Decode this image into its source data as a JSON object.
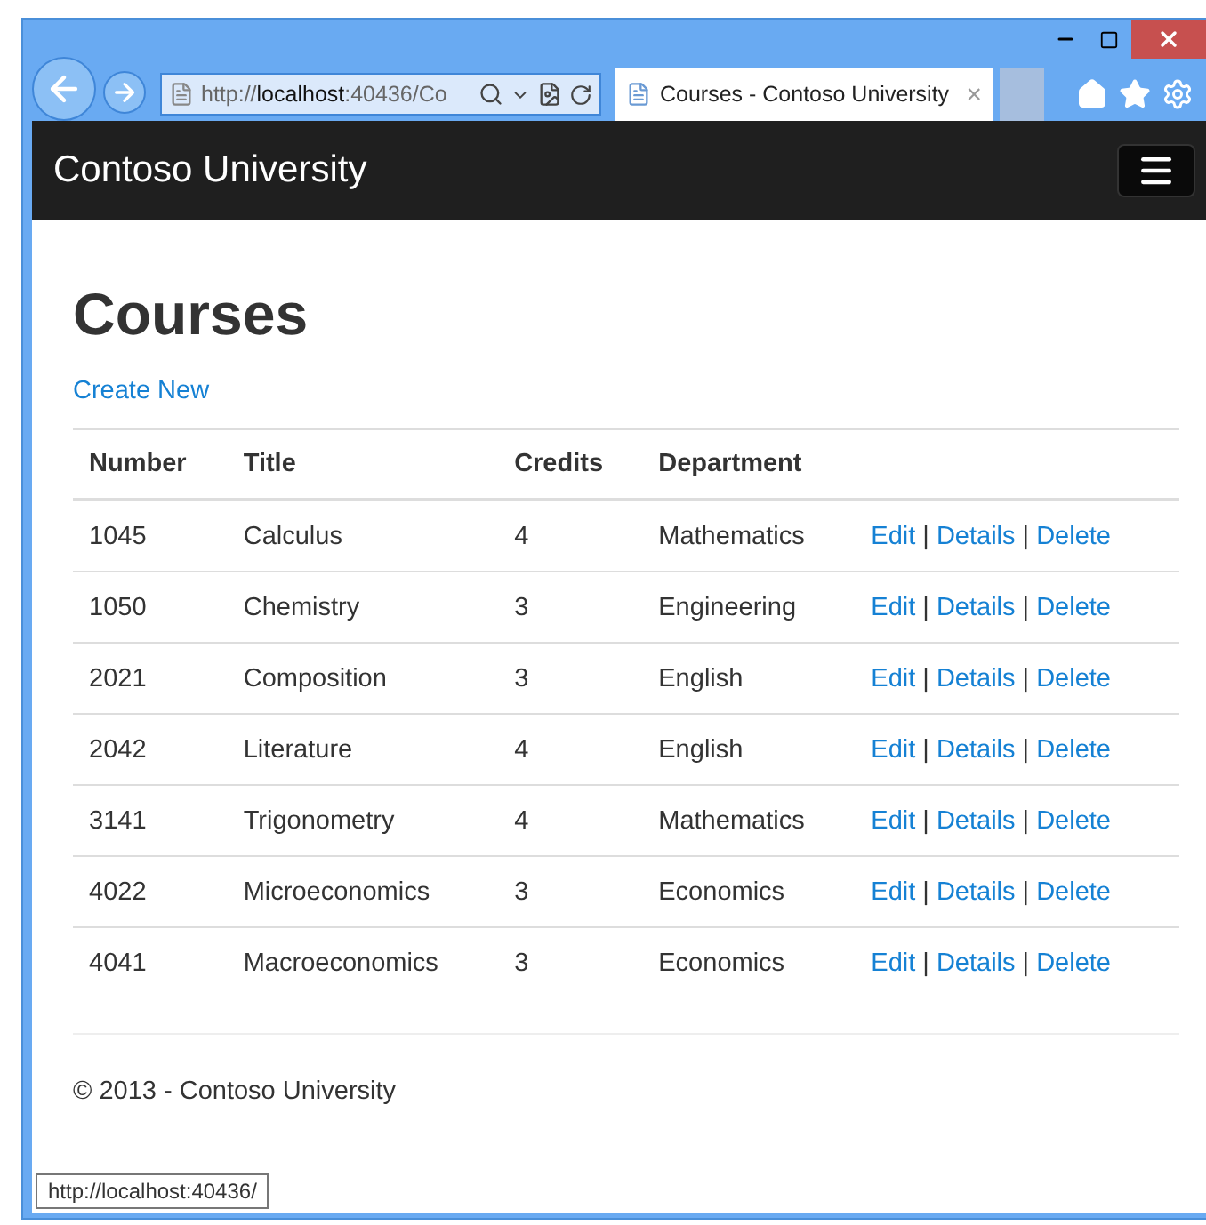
{
  "browser": {
    "address": "http://**localhost**:40436/Co",
    "tab_title": "Courses - Contoso University",
    "tab_close": "×",
    "status_url": "http://localhost:40436/"
  },
  "navbar": {
    "brand": "Contoso University"
  },
  "page": {
    "heading": "Courses",
    "create_link": "Create New"
  },
  "table": {
    "columns": [
      "Number",
      "Title",
      "Credits",
      "Department"
    ],
    "rows": [
      {
        "cells": [
          "1045",
          "Calculus",
          "4",
          "Mathematics"
        ],
        "actions": [
          "Edit",
          "Details",
          "Delete"
        ]
      },
      {
        "cells": [
          "1050",
          "Chemistry",
          "3",
          "Engineering"
        ],
        "actions": [
          "Edit",
          "Details",
          "Delete"
        ]
      },
      {
        "cells": [
          "2021",
          "Composition",
          "3",
          "English"
        ],
        "actions": [
          "Edit",
          "Details",
          "Delete"
        ]
      },
      {
        "cells": [
          "2042",
          "Literature",
          "4",
          "English"
        ],
        "actions": [
          "Edit",
          "Details",
          "Delete"
        ]
      },
      {
        "cells": [
          "3141",
          "Trigonometry",
          "4",
          "Mathematics"
        ],
        "actions": [
          "Edit",
          "Details",
          "Delete"
        ]
      },
      {
        "cells": [
          "4022",
          "Microeconomics",
          "3",
          "Economics"
        ],
        "actions": [
          "Edit",
          "Details",
          "Delete"
        ]
      },
      {
        "cells": [
          "4041",
          "Macroeconomics",
          "3",
          "Economics"
        ],
        "actions": [
          "Edit",
          "Details",
          "Delete"
        ]
      }
    ],
    "separator": "|"
  },
  "footer": {
    "text": "© 2013 - Contoso University"
  }
}
